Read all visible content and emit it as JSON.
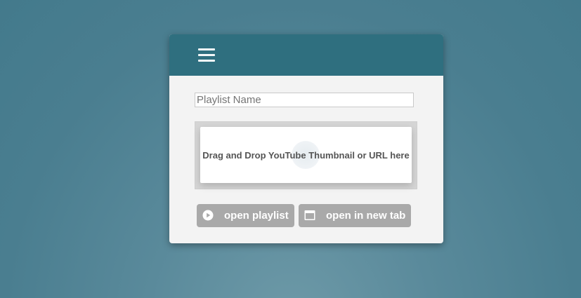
{
  "header": {
    "menu_icon": "hamburger-menu-icon"
  },
  "form": {
    "playlist_placeholder": "Playlist Name",
    "playlist_value": ""
  },
  "dropzone": {
    "text": "Drag and Drop YouTube Thumbnail or URL here"
  },
  "actions": {
    "open_playlist": {
      "label": "open playlist",
      "icon": "play-circle-icon"
    },
    "open_new_tab": {
      "label": "open in new tab",
      "icon": "window-icon"
    }
  },
  "colors": {
    "header": "#2f6f7f",
    "card": "#f3f3f3",
    "button": "#a9a9a9",
    "background": "#4a7e90"
  }
}
